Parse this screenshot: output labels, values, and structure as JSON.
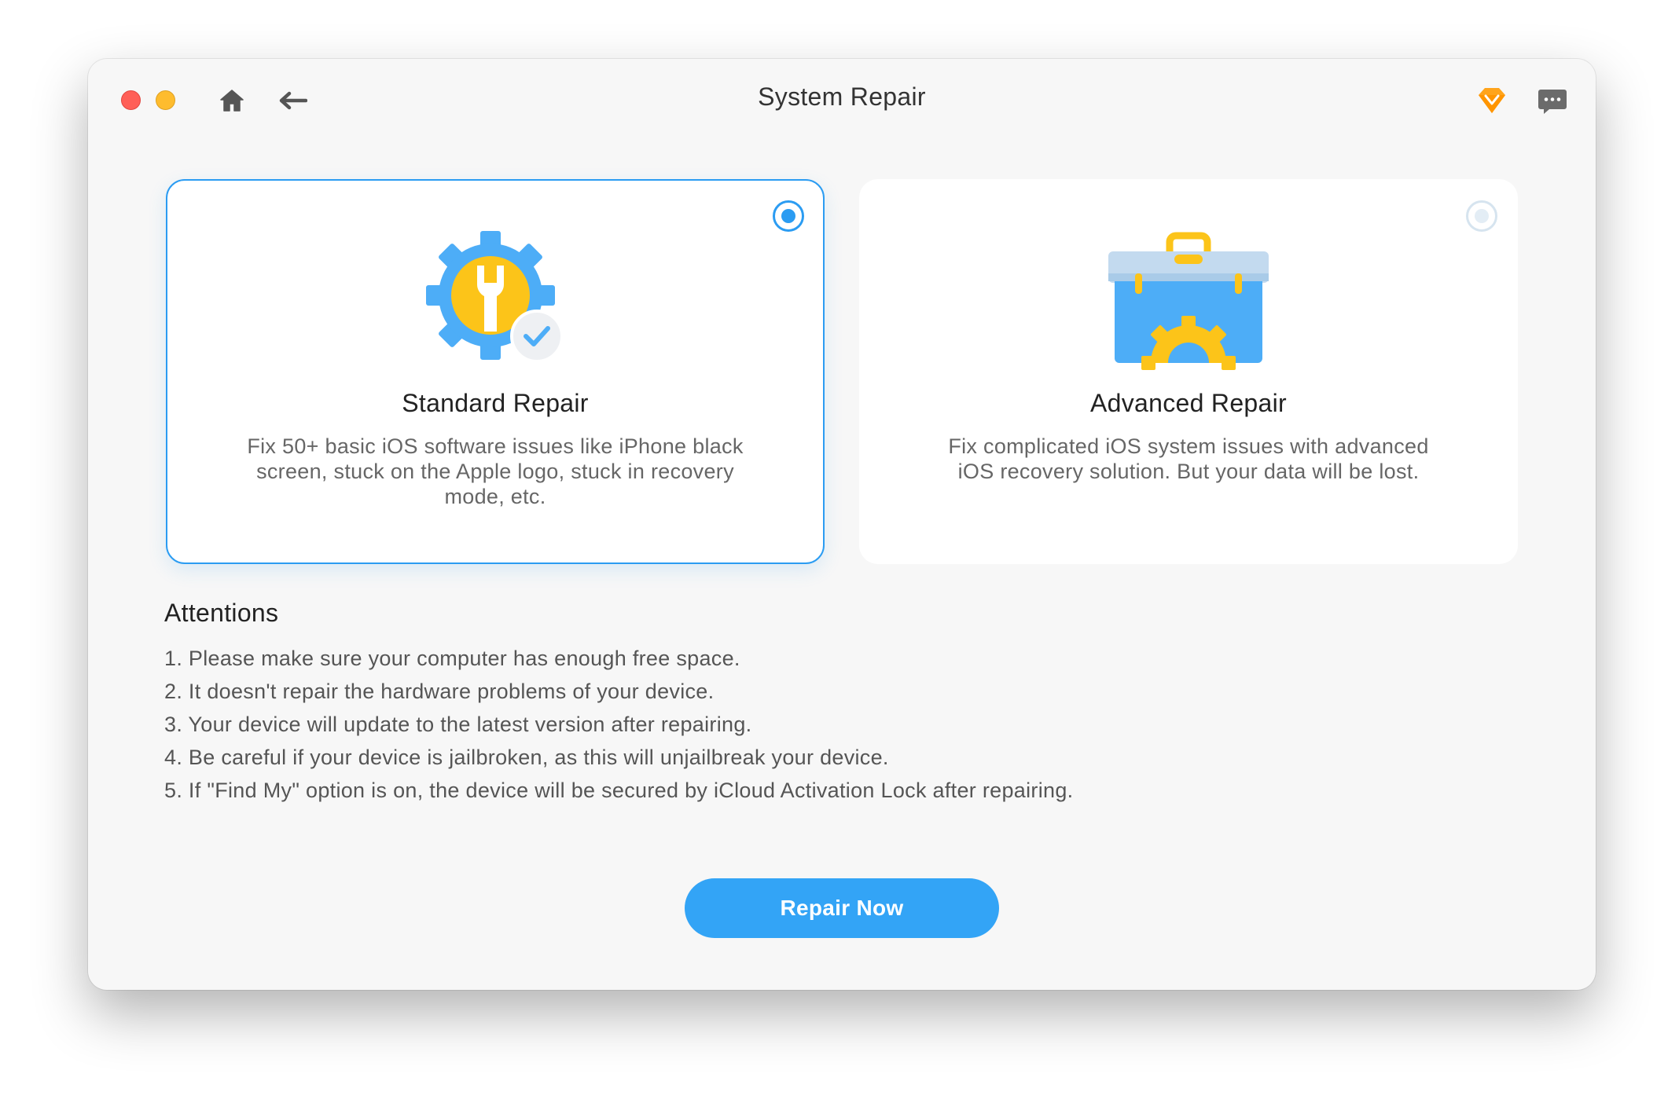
{
  "window": {
    "title": "System Repair"
  },
  "toolbar": {
    "home_icon": "home-icon",
    "back_icon": "back-arrow-icon",
    "premium_icon": "diamond-icon",
    "feedback_icon": "chat-bubble-icon"
  },
  "cards": [
    {
      "title": "Standard Repair",
      "description": "Fix 50+ basic iOS software issues like iPhone black screen, stuck on the Apple logo, stuck in recovery mode, etc.",
      "selected": true,
      "icon": "gear-wrench-check-icon"
    },
    {
      "title": "Advanced Repair",
      "description": "Fix complicated iOS system issues with advanced iOS recovery solution. But your data will be lost.",
      "selected": false,
      "icon": "toolbox-gear-icon"
    }
  ],
  "attentions": {
    "heading": "Attentions",
    "items": [
      "1. Please make sure your computer has enough free space.",
      "2. It doesn't repair the hardware problems of your device.",
      "3. Your device will update to the latest version after repairing.",
      "4. Be careful if your device is jailbroken, as this will unjailbreak your device.",
      "5. If \"Find My\" option is on, the device will be secured by iCloud Activation Lock after repairing."
    ]
  },
  "actions": {
    "repair_label": "Repair Now"
  },
  "colors": {
    "accent": "#2b9cf2",
    "button": "#33a4f6",
    "close": "#ff5f57",
    "minimize": "#febc2e",
    "icon_yellow": "#fcc419",
    "icon_blue": "#4dadf7"
  }
}
